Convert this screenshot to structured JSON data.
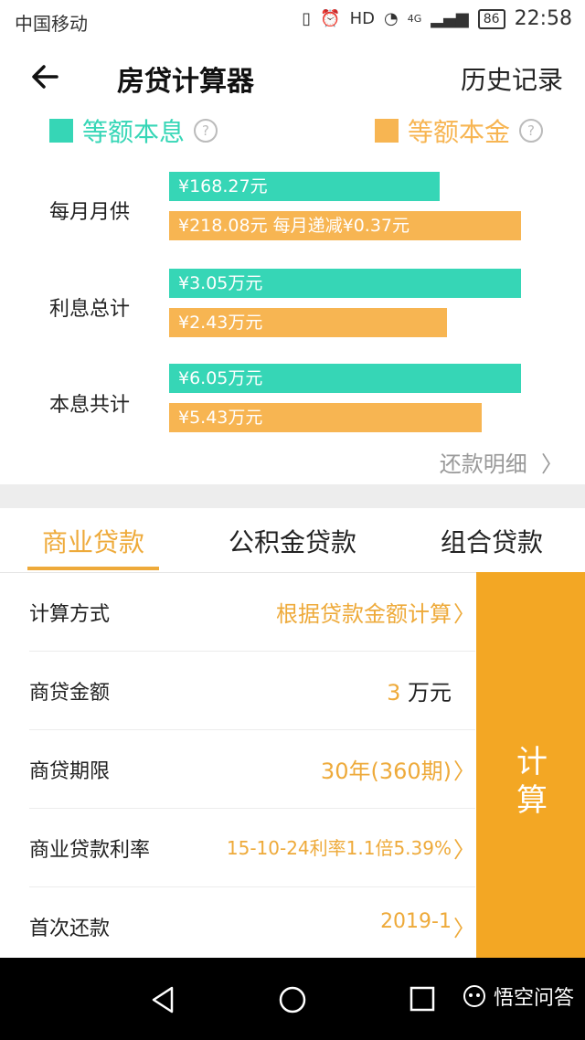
{
  "status_bar": {
    "carrier": "中国移动",
    "network": "4G",
    "battery": "86",
    "time": "22:58"
  },
  "header": {
    "title": "房贷计算器",
    "history": "历史记录"
  },
  "legend": {
    "equal_installment": "等额本息",
    "equal_principal": "等额本金",
    "help": "?",
    "colors": {
      "teal": "#36d6b6",
      "orange": "#f7b552"
    }
  },
  "compare": {
    "monthly": {
      "label": "每月月供",
      "installment": "¥168.27元",
      "principal": "¥218.08元  每月递减¥0.37元"
    },
    "interest": {
      "label": "利息总计",
      "installment": "¥3.05万元",
      "principal": "¥2.43万元"
    },
    "total": {
      "label": "本息共计",
      "installment": "¥6.05万元",
      "principal": "¥5.43万元"
    },
    "detail_link": "还款明细"
  },
  "tabs": [
    {
      "label": "商业贷款",
      "active": true
    },
    {
      "label": "公积金贷款",
      "active": false
    },
    {
      "label": "组合贷款",
      "active": false
    }
  ],
  "form": {
    "method": {
      "label": "计算方式",
      "value": "根据贷款金额计算"
    },
    "amount": {
      "label": "商贷金额",
      "value": "3",
      "unit": "万元"
    },
    "term": {
      "label": "商贷期限",
      "value": "30年(360期)"
    },
    "rate": {
      "label": "商业贷款利率",
      "value": "15-10-24利率1.1倍5.39%"
    },
    "first": {
      "label": "首次还款",
      "value": "2019-1"
    }
  },
  "calculate_button": {
    "line1": "计",
    "line2": "算"
  },
  "watermark": "悟空问答",
  "accent_color": "#f3a724"
}
